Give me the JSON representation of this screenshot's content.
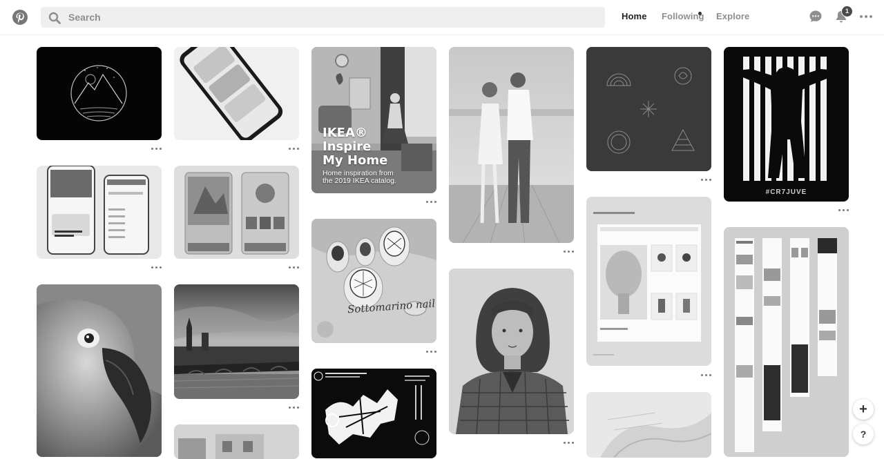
{
  "header": {
    "logo_icon": "pinterest-logo-icon",
    "search": {
      "placeholder": "Search",
      "value": ""
    },
    "nav": {
      "home": "Home",
      "following": "Following",
      "explore": "Explore"
    },
    "notification_count": "1"
  },
  "pins": {
    "ikea": {
      "title": "IKEA®\nInspire\nMy Home",
      "subtitle": "Home inspiration from\nthe 2019 IKEA catalog."
    },
    "nail": {
      "script_text": "Sottomarino nail"
    },
    "cristiano": {
      "caption": "#CR7JUVE"
    }
  },
  "floating": {
    "add_label": "+",
    "help_label": "?"
  },
  "colors": {
    "accent": "#111111",
    "search_bg": "#efefef",
    "icon_gray": "#8e8e8e"
  }
}
